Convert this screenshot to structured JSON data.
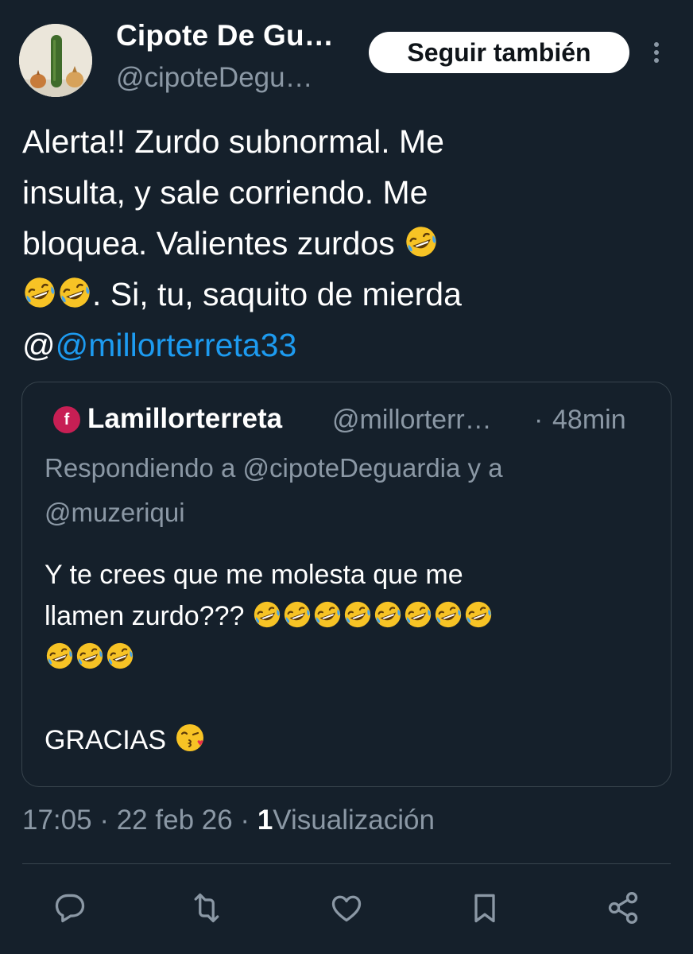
{
  "author": {
    "display_name": "Cipote De Gu…",
    "handle": "@cipoteDegu…",
    "avatar_icon": "avatar-cucumber-onions"
  },
  "follow_button": {
    "label": "Seguir también"
  },
  "tweet": {
    "line1": "Alerta!! Zurdo subnormal. Me",
    "line2": "insulta, y sale corriendo. Me",
    "line3": "bloquea. Valientes zurdos",
    "line4": ". Si, tu, saquito de mierda",
    "line5_prefix": "@",
    "mention": "@millorterreta33",
    "emoji_name": "rolling-on-floor-laughing"
  },
  "quoted_tweet": {
    "avatar_letter": "f",
    "name": "Lamillorterreta",
    "handle": "@millorterr…",
    "separator": "·",
    "time": "48min",
    "reply_line1": "Respondiendo a @cipoteDeguardia y a",
    "reply_line2": "@muzeriqui",
    "body_line1": "Y te crees que me molesta que me",
    "body_line2": "llamen zurdo???",
    "closing": "GRACIAS",
    "closing_emoji": "face-blowing-a-kiss"
  },
  "meta": {
    "time": "17:05",
    "sep1": "·",
    "date": "22 feb 26",
    "sep2": "·",
    "views_count": "1",
    "views_label": "Visualización"
  },
  "colors": {
    "background": "#15202b",
    "accent": "#1d9bf0",
    "secondary_text": "#8b98a5",
    "border": "#38444d"
  }
}
